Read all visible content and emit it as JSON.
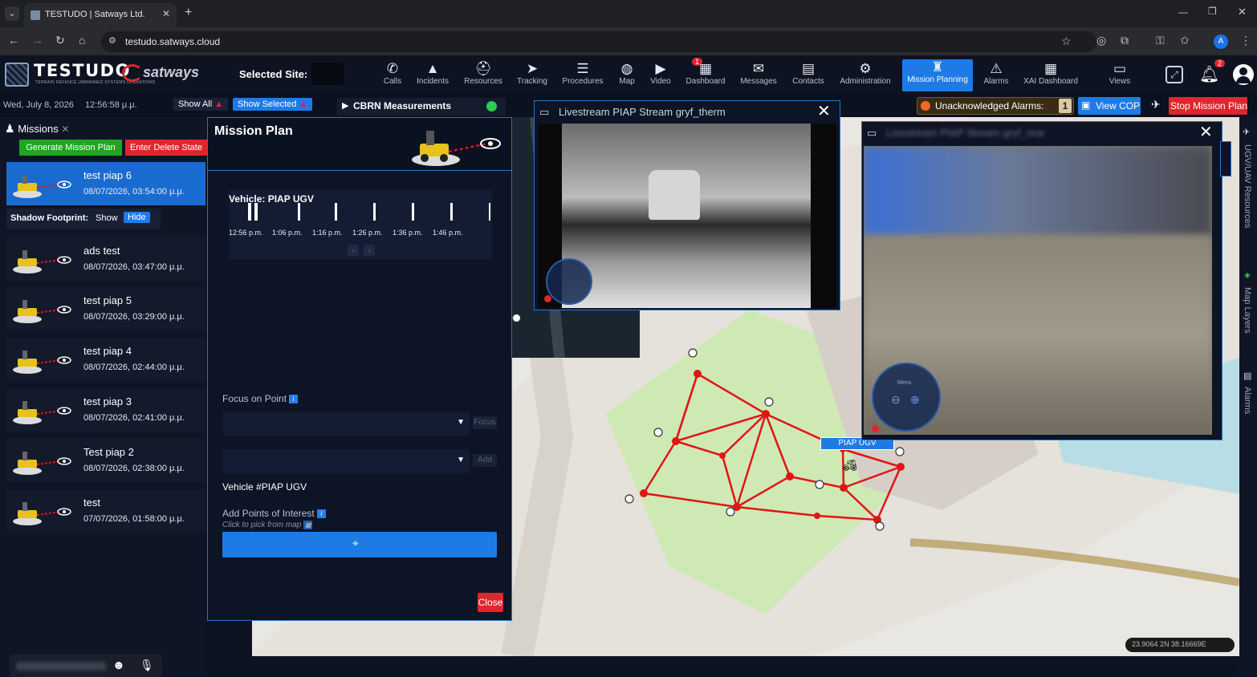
{
  "browser": {
    "tab_title": "TESTUDO | Satways Ltd.",
    "url": "testudo.satways.cloud",
    "profile_initial": "A"
  },
  "header": {
    "brand": "TESTUDO",
    "brand_sub": "TERRAIN DEFENCE UNMANNED SYSTEMS OPERATIONS",
    "partner": "satways",
    "selected_site_label": "Selected Site:",
    "nav": [
      {
        "label": "Calls",
        "icon": "phone-icon"
      },
      {
        "label": "Incidents",
        "icon": "warning-icon"
      },
      {
        "label": "Resources",
        "icon": "resources-icon"
      },
      {
        "label": "Tracking",
        "icon": "tracking-icon"
      },
      {
        "label": "Procedures",
        "icon": "procedures-icon"
      },
      {
        "label": "Map",
        "icon": "globe-icon"
      },
      {
        "label": "Video",
        "icon": "video-icon"
      },
      {
        "label": "Dashboard",
        "icon": "dashboard-icon"
      },
      {
        "label": "Messages",
        "icon": "mail-icon"
      },
      {
        "label": "Contacts",
        "icon": "contacts-icon"
      },
      {
        "label": "Administration",
        "icon": "gear-icon"
      },
      {
        "label": "Mission Planning",
        "icon": "mission-planning-icon"
      },
      {
        "label": "Alarms",
        "icon": "alarm-icon"
      },
      {
        "label": "XAI Dashboard",
        "icon": "xai-dashboard-icon"
      },
      {
        "label": "Views",
        "icon": "views-icon"
      }
    ],
    "notification_count": "2",
    "incidents_badge": "1"
  },
  "info_bar": {
    "date": "Wed, July 8, 2026",
    "time": "12:56:58 μ.μ.",
    "show_all": "Show All",
    "show_selected": "Show Selected",
    "cbrn": "CBRN Measurements",
    "unack_alarms_label": "Unacknowledged Alarms:",
    "unack_alarms_count": "1",
    "view_cop": "View COP",
    "stop_mission": "Stop Mission Plan"
  },
  "missions": {
    "title": "Missions",
    "generate": "Generate Mission Plan",
    "delete_state": "Enter Delete State",
    "shadow_footprint_label": "Shadow Footprint:",
    "shadow_show": "Show",
    "shadow_hide": "Hide",
    "items": [
      {
        "name": "test piap 6",
        "date": "08/07/2026, 03:54:00 μ.μ."
      },
      {
        "name": "ads test",
        "date": "08/07/2026, 03:47:00 μ.μ."
      },
      {
        "name": "test piap 5",
        "date": "08/07/2026, 03:29:00 μ.μ."
      },
      {
        "name": "test piap 4",
        "date": "08/07/2026, 02:44:00 μ.μ."
      },
      {
        "name": "test piap 3",
        "date": "08/07/2026, 02:41:00 μ.μ."
      },
      {
        "name": "Test piap 2",
        "date": "08/07/2026, 02:38:00 μ.μ."
      },
      {
        "name": "test",
        "date": "07/07/2026, 01:58:00 μ.μ."
      }
    ]
  },
  "mission_plan": {
    "title": "Mission Plan",
    "vehicle_title": "Vehicle: PIAP UGV",
    "timeline_labels": [
      "12:56 p.m.",
      "1:06 p.m.",
      "1:16 p.m.",
      "1:26 p.m.",
      "1:36 p.m.",
      "1:46 p.m."
    ],
    "focus_label": "Focus on Point",
    "focus_btn": "Focus",
    "add_btn": "Add",
    "vehicle_id": "Vehicle #PIAP UGV",
    "poi_label": "Add Points of Interest",
    "poi_hint": "Click to pick from map",
    "close": "Close"
  },
  "streams": {
    "s1_title": "Livestream PIAP Stream gryf_therm",
    "s2_title": "Livestream PIAP Stream gryf_rear",
    "ptz_menu": "Menu"
  },
  "map": {
    "vehicle_label": "PIAP UGV",
    "coords": "23.9064 2N  38.16669E"
  },
  "right_rail": {
    "resources": "UGV/UAV Resources",
    "layers": "Map Layers",
    "alarms": "Alarms"
  },
  "colors": {
    "accent": "#1e7be6",
    "danger": "#e0262c",
    "success": "#1fa51f",
    "route": "#e01515"
  }
}
